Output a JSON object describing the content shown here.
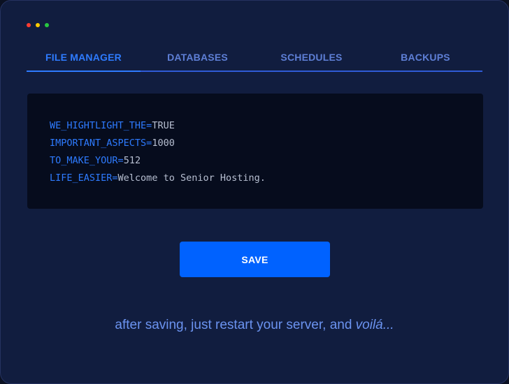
{
  "window": {
    "controls": [
      {
        "name": "close-dot",
        "color": "#ff3b30"
      },
      {
        "name": "minimize-dot",
        "color": "#ffcc00"
      },
      {
        "name": "maximize-dot",
        "color": "#28c840"
      }
    ]
  },
  "tabs": [
    {
      "label": "FILE MANAGER",
      "active": true
    },
    {
      "label": "DATABASES",
      "active": false
    },
    {
      "label": "SCHEDULES",
      "active": false
    },
    {
      "label": "BACKUPS",
      "active": false
    }
  ],
  "code": {
    "lines": [
      {
        "key": "WE_HIGHTLIGHT_THE",
        "eq": "=",
        "value": "TRUE"
      },
      {
        "key": "IMPORTANT_ASPECTS",
        "eq": "=",
        "value": "1000"
      },
      {
        "key": "TO_MAKE_YOUR",
        "eq": "=",
        "value": "512"
      },
      {
        "key": "LIFE_EASIER",
        "eq": "=",
        "value": "Welcome to Senior Hosting."
      }
    ]
  },
  "actions": {
    "save_label": "SAVE"
  },
  "footer": {
    "text": "after saving, just restart your server, and ",
    "emphasis": "voilá..."
  },
  "colors": {
    "accent": "#2e7bff",
    "button": "#0062ff",
    "background": "#111d3f",
    "code_background": "#060c1d"
  }
}
